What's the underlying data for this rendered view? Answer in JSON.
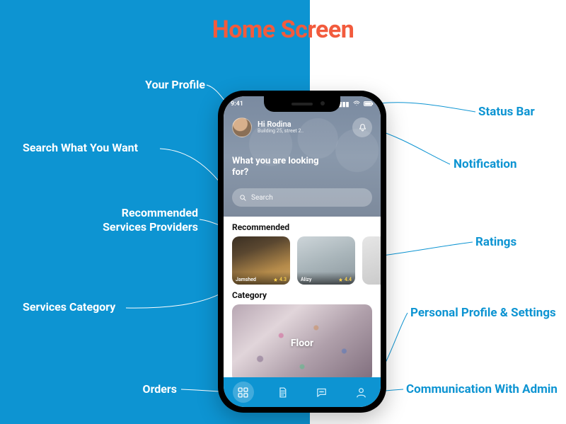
{
  "title": "Home Screen",
  "callouts": {
    "profile": "Your Profile",
    "search": "Search What You Want",
    "recommended_l1": "Recommended",
    "recommended_l2": "Services Providers",
    "category": "Services Category",
    "orders": "Orders",
    "statusbar": "Status Bar",
    "notification": "Notification",
    "ratings": "Ratings",
    "settings": "Personal Profile & Settings",
    "comm": "Communication With Admin"
  },
  "phone": {
    "status": {
      "time": "9:41"
    },
    "greeting": {
      "hi": "Hi Rodina",
      "address": "Building 25, street 2.."
    },
    "prompt": "What you are looking for?",
    "search_placeholder": "Search",
    "sections": {
      "recommended": "Recommended",
      "category": "Category"
    },
    "recommended": [
      {
        "name": "Jamshed",
        "rating": "4.3"
      },
      {
        "name": "Alizy",
        "rating": "4.4"
      }
    ],
    "category_item": "Floor"
  }
}
